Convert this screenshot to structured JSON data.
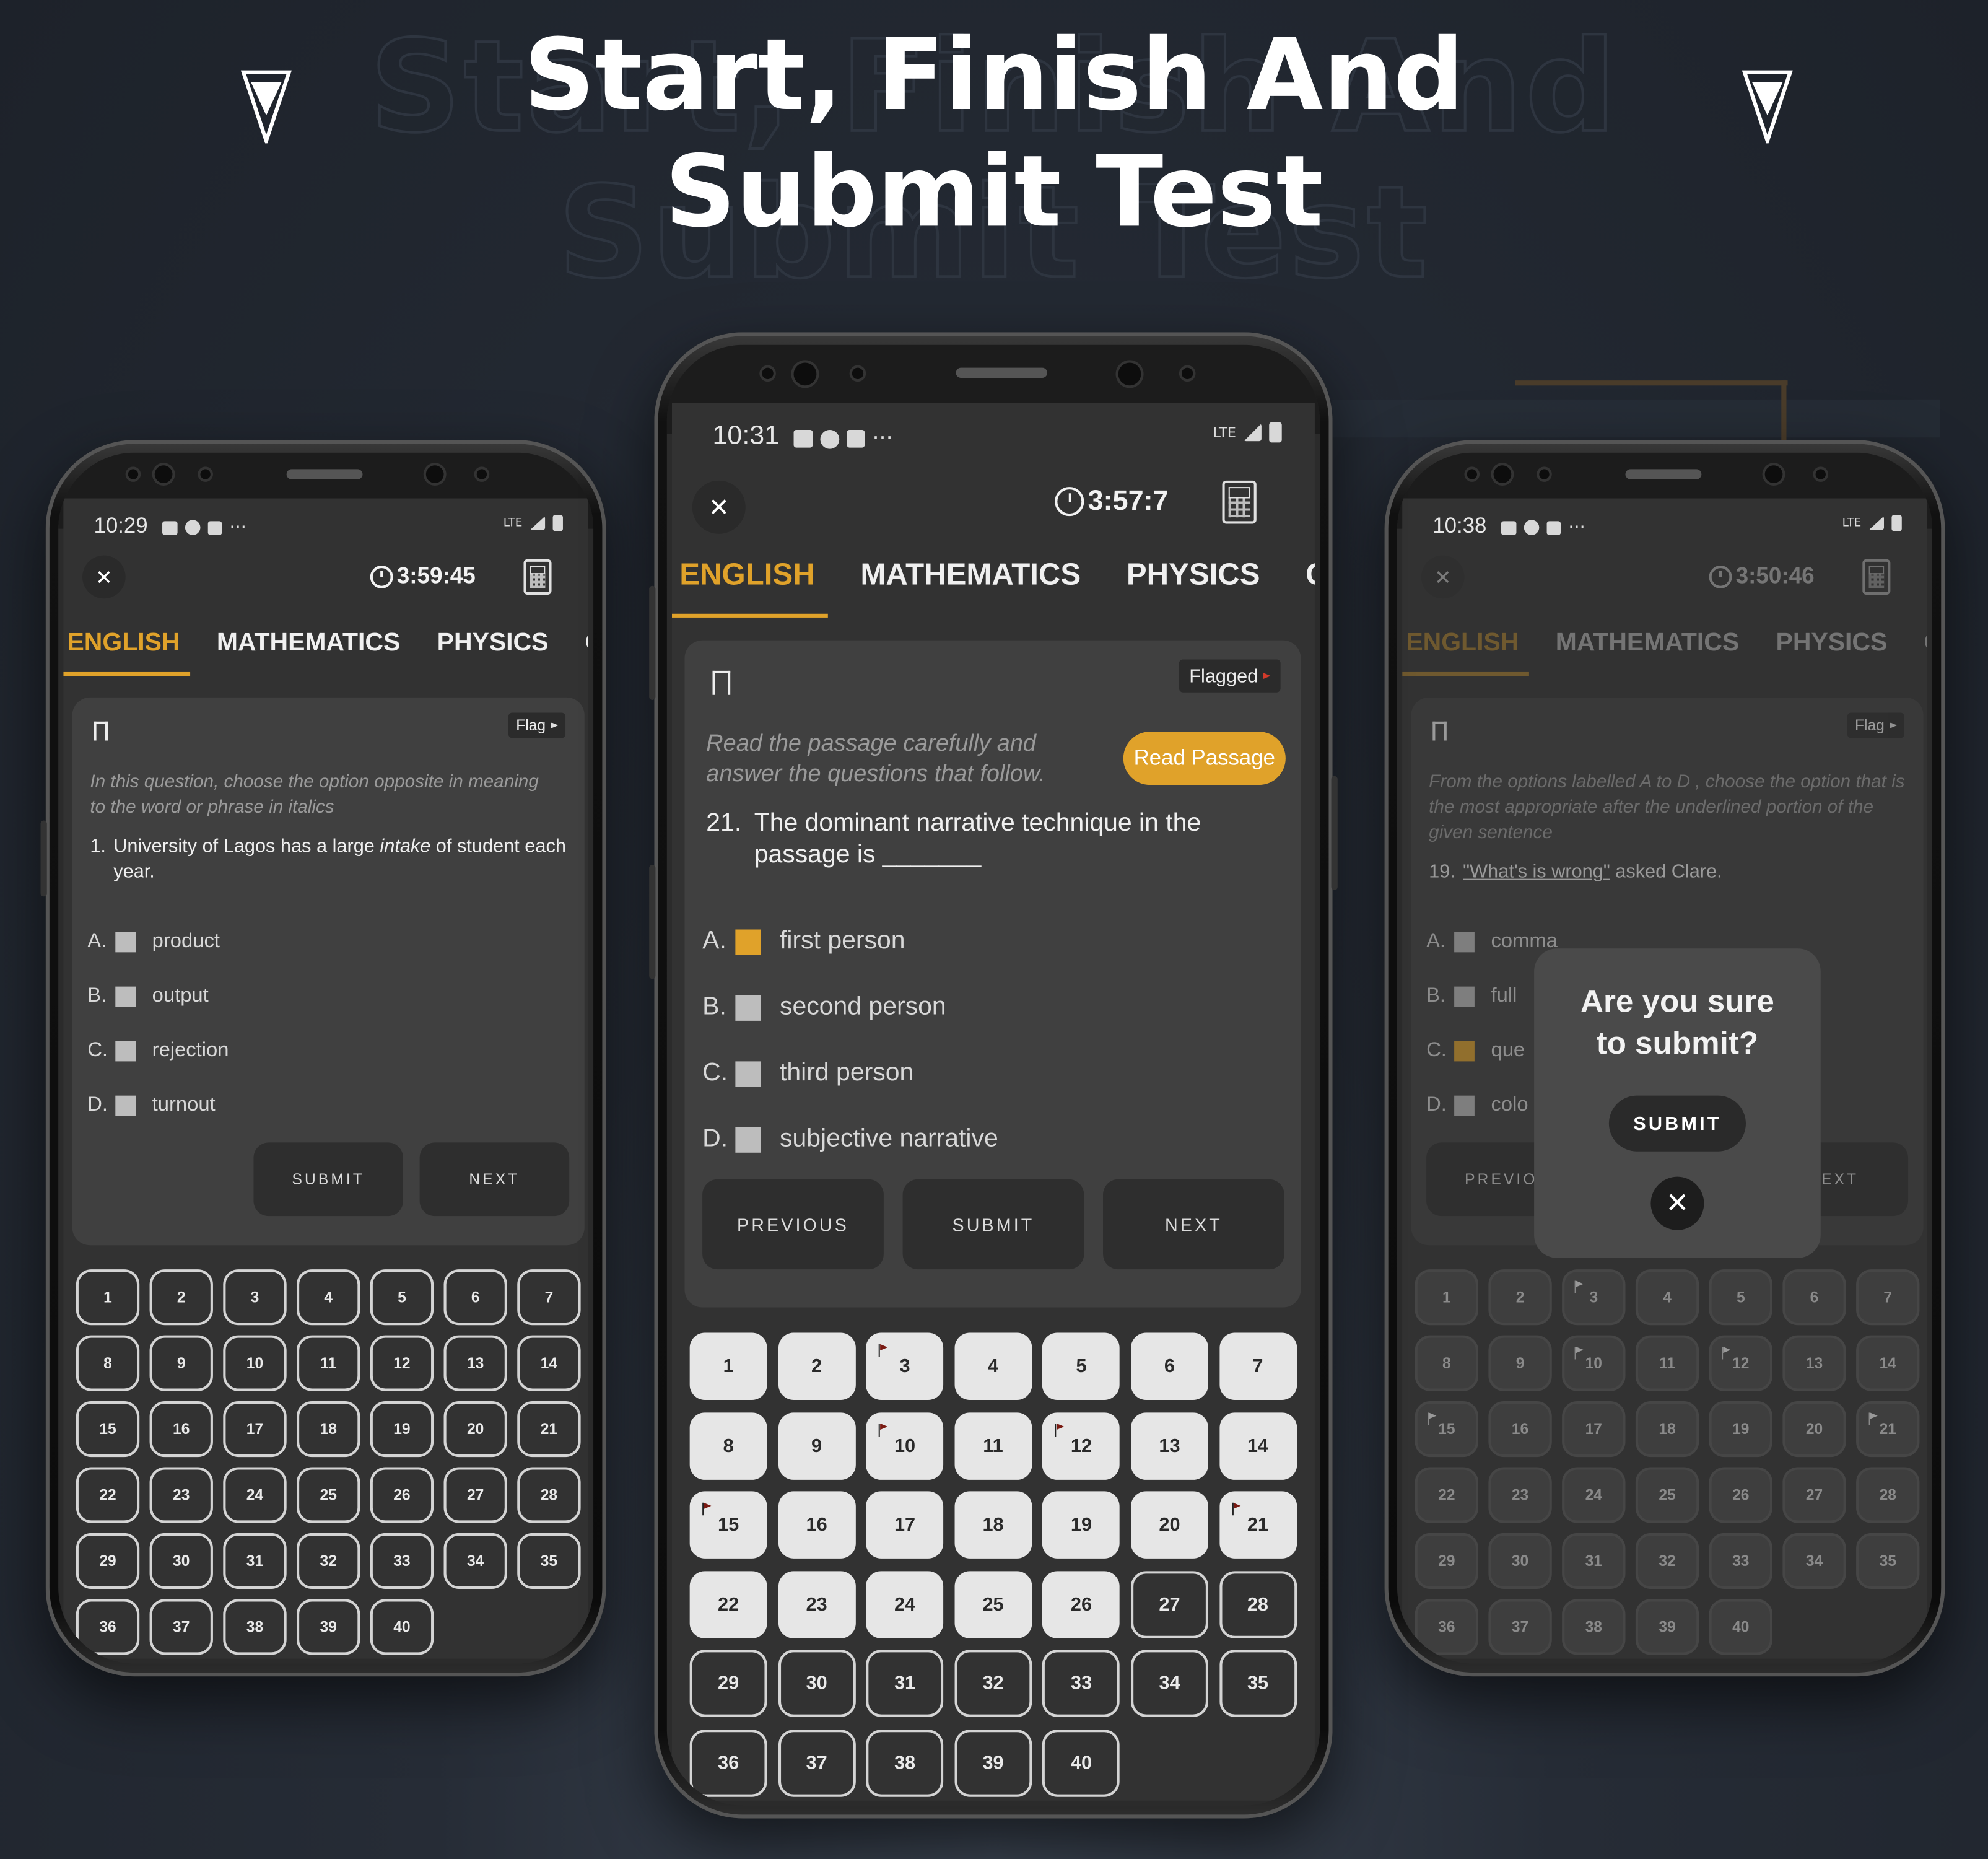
{
  "headline": {
    "line1": "Start, Finish And",
    "line2": "Submit Test"
  },
  "logo_icon": "chevron-logo-icon",
  "colors": {
    "accent": "#e0a22a",
    "background": "#1f242d",
    "flag_red": "#d23a2a"
  },
  "tabs": [
    "ENGLISH",
    "MATHEMATICS",
    "PHYSICS",
    "CH"
  ],
  "numbers": [
    "1",
    "2",
    "3",
    "4",
    "5",
    "6",
    "7",
    "8",
    "9",
    "10",
    "11",
    "12",
    "13",
    "14",
    "15",
    "16",
    "17",
    "18",
    "19",
    "20",
    "21",
    "22",
    "23",
    "24",
    "25",
    "26",
    "27",
    "28",
    "29",
    "30",
    "31",
    "32",
    "33",
    "34",
    "35",
    "36",
    "37",
    "38",
    "39",
    "40"
  ],
  "phones": {
    "left": {
      "status_time": "10:29",
      "network": "LTE",
      "timer": "3:59:45",
      "flag_label": "Flag",
      "instruction": "In this question, choose the option opposite in meaning to the word or phrase in italics",
      "q_number": "1.",
      "q_pre": "University of Lagos has a large ",
      "q_italic": "intake",
      "q_post": " of student each year.",
      "options": [
        {
          "letter": "A.",
          "text": "product",
          "selected": false
        },
        {
          "letter": "B.",
          "text": "output",
          "selected": false
        },
        {
          "letter": "C.",
          "text": "rejection",
          "selected": false
        },
        {
          "letter": "D.",
          "text": "turnout",
          "selected": false
        }
      ],
      "buttons": {
        "submit": "SUBMIT",
        "next": "NEXT"
      },
      "answered": [],
      "flagged": []
    },
    "center": {
      "status_time": "10:31",
      "network": "LTE",
      "timer": "3:57:7",
      "flag_label": "Flagged",
      "instruction": "Read the passage carefully and answer the questions that follow.",
      "read_passage": "Read Passage",
      "q_number": "21.",
      "q_text": "The dominant narrative technique in the passage is _______",
      "options": [
        {
          "letter": "A.",
          "text": "first person",
          "selected": true
        },
        {
          "letter": "B.",
          "text": "second person",
          "selected": false
        },
        {
          "letter": "C.",
          "text": "third person",
          "selected": false
        },
        {
          "letter": "D.",
          "text": "subjective narrative",
          "selected": false
        }
      ],
      "buttons": {
        "previous": "PREVIOUS",
        "submit": "SUBMIT",
        "next": "NEXT"
      },
      "answered": [
        1,
        2,
        3,
        4,
        5,
        6,
        7,
        8,
        9,
        10,
        11,
        12,
        13,
        14,
        15,
        16,
        17,
        18,
        19,
        20,
        21,
        22,
        23,
        24,
        25,
        26
      ],
      "flagged": [
        3,
        10,
        12,
        15,
        21
      ]
    },
    "right": {
      "status_time": "10:38",
      "network": "LTE",
      "timer": "3:50:46",
      "flag_label": "Flag",
      "instruction": "From the options labelled A to D , choose the option that is the most appropriate after the underlined portion of the given sentence",
      "q_number": "19.",
      "q_underlined": "\"What's is wrong\"",
      "q_post": " asked Clare.",
      "options": [
        {
          "letter": "A.",
          "text": "comma",
          "selected": false
        },
        {
          "letter": "B.",
          "text": "full",
          "selected": false
        },
        {
          "letter": "C.",
          "text": "que",
          "selected": true
        },
        {
          "letter": "D.",
          "text": "colo",
          "selected": false
        }
      ],
      "buttons": {
        "previous": "PREVIO",
        "next": "NEXT"
      },
      "dialog": {
        "title": "Are you sure to submit?",
        "submit": "SUBMIT"
      },
      "answered": [],
      "flagged": [
        3,
        10,
        12,
        15,
        21
      ]
    }
  }
}
